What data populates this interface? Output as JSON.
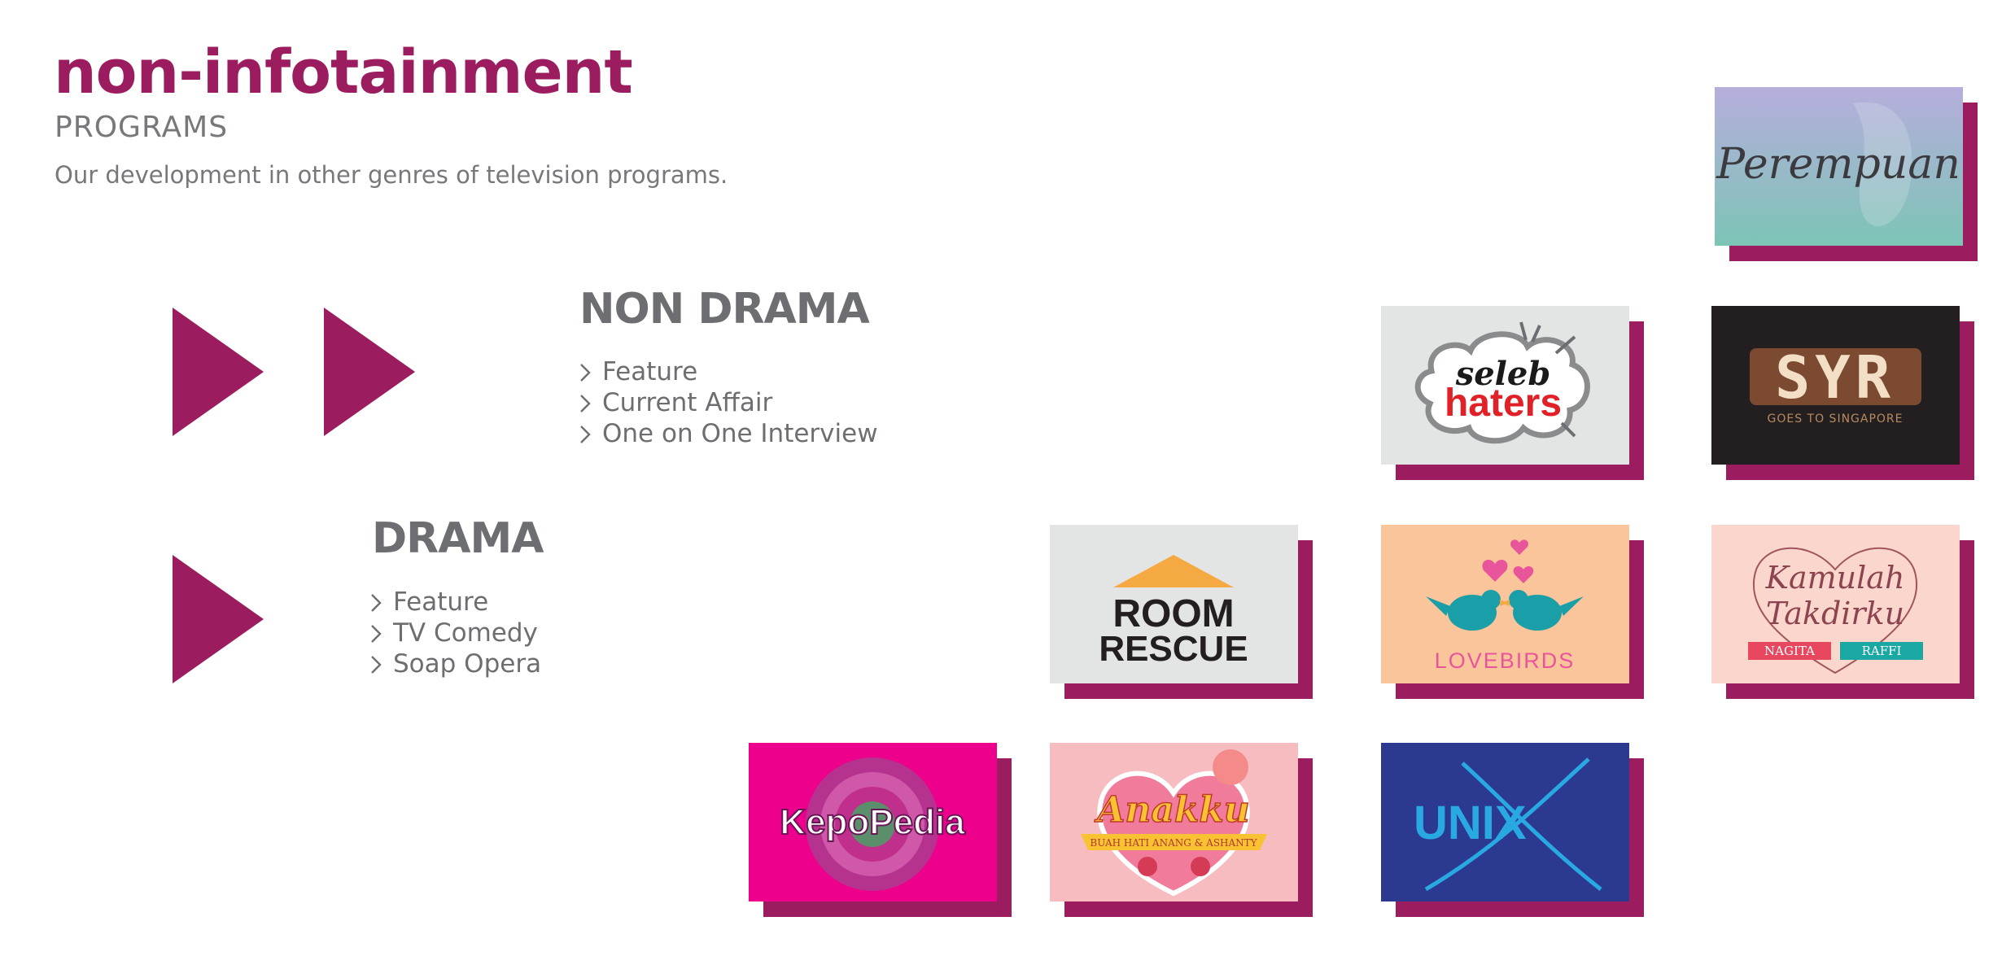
{
  "header": {
    "title": "non-infotainment",
    "subtitle": "PROGRAMS",
    "description": "Our development in other genres of television programs."
  },
  "sections": {
    "non_drama": {
      "title": "NON DRAMA",
      "items": [
        "Feature",
        "Current Affair",
        "One on One Interview"
      ]
    },
    "drama": {
      "title": "DRAMA",
      "items": [
        "Feature",
        "TV Comedy",
        "Soap Opera"
      ]
    }
  },
  "programs": {
    "perempuan": {
      "logo_text": "Perempuan"
    },
    "seleb_haters": {
      "logo_top": "seleb",
      "logo_bottom": "haters"
    },
    "syr": {
      "logo_text": "SYR",
      "tagline": "GOES TO SINGAPORE"
    },
    "room_rescue": {
      "line1": "ROOM",
      "line2": "RESCUE"
    },
    "lovebirds": {
      "logo_text": "LOVEBIRDS"
    },
    "kamulah_takdirku": {
      "line1": "Kamulah",
      "line2": "Takdirku",
      "left_name": "NAGITA",
      "right_name": "RAFFI"
    },
    "kepopedia": {
      "logo_text": "KepoPedia"
    },
    "anakku": {
      "logo_text": "Anakku",
      "ribbon": "BUAH HATI ANANG & ASHANTY"
    },
    "unix": {
      "logo_text": "UNIX"
    }
  },
  "colors": {
    "accent": "#9c1d5f",
    "text_gray": "#6d6e71",
    "light_gray": "#77787b"
  }
}
